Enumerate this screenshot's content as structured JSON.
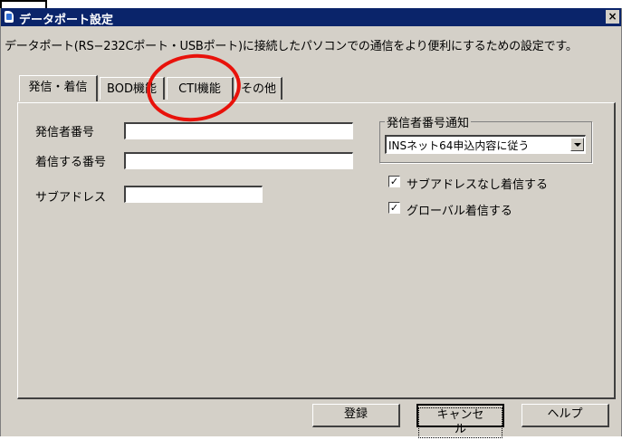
{
  "window": {
    "title": "データポート設定",
    "close_label": "×"
  },
  "description": "データポート(RS−232Cポート・USBポート)に接続したパソコンでの通信をより便利にするための設定です。",
  "tabs": [
    {
      "label": "発信・着信",
      "active": true
    },
    {
      "label": "BOD機能",
      "active": false
    },
    {
      "label": "CTI機能",
      "active": false
    },
    {
      "label": "その他",
      "active": false
    }
  ],
  "form": {
    "caller_number_label": "発信者番号",
    "caller_number_value": "",
    "incoming_number_label": "着信する番号",
    "incoming_number_value": "",
    "subaddress_label": "サブアドレス",
    "subaddress_value": ""
  },
  "caller_id_notify": {
    "group_title": "発信者番号通知",
    "selected": "INSネット64申込内容に従う"
  },
  "checkboxes": [
    {
      "label": "サブアドレスなし着信する",
      "checked": true
    },
    {
      "label": "グローバル着信する",
      "checked": true
    }
  ],
  "buttons": {
    "register": "登録",
    "cancel": "キャンセル",
    "help": "ヘルプ"
  },
  "check_mark": "☑",
  "annotation_color": "#e8120b"
}
